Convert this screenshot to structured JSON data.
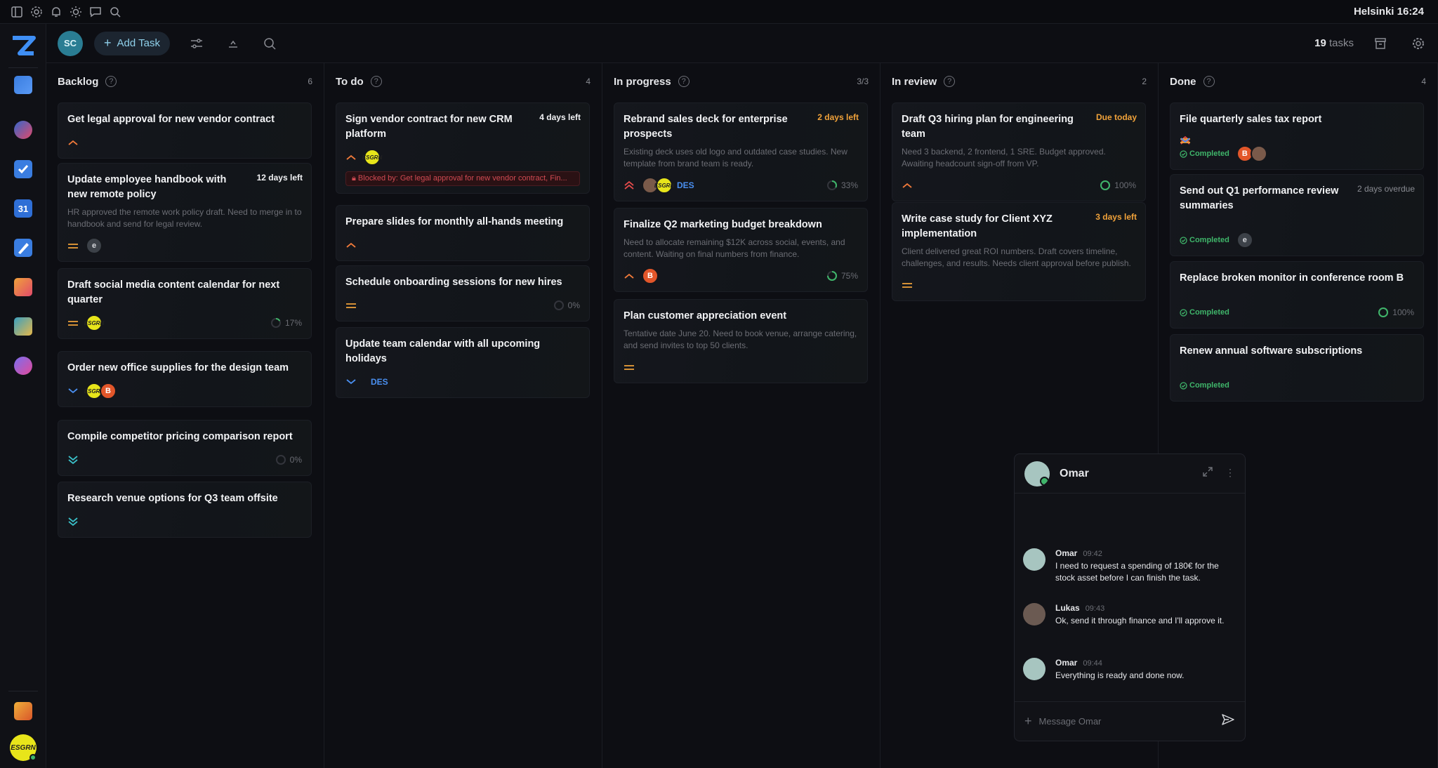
{
  "topbar": {
    "clock": "Helsinki 16:24"
  },
  "toolbar": {
    "user_initials": "SC",
    "add_task_label": "Add Task",
    "task_count": "19",
    "task_count_suffix": "tasks"
  },
  "columns": [
    {
      "title": "Backlog",
      "count": "6",
      "cards": [
        {
          "title": "Get legal approval for new vendor contract",
          "priority": "high"
        },
        {
          "title": "Update employee handbook with new remote policy",
          "due": "12 days left",
          "description": "HR approved the remote work policy draft. Need to merge in to handbook and send for legal review.",
          "priority": "medium",
          "assignees": [
            "e"
          ]
        },
        {
          "title": "Draft social media content calendar for next quarter",
          "priority": "medium",
          "assignees": [
            "ESGRN"
          ],
          "progress": "17%"
        },
        {
          "title": "Order new office supplies for the design team",
          "priority": "low",
          "assignees": [
            "ESGRN",
            "B"
          ]
        },
        {
          "title": "Compile competitor pricing comparison report",
          "priority": "lowest",
          "progress": "0%"
        },
        {
          "title": "Research venue options for Q3 team offsite",
          "priority": "lowest"
        }
      ]
    },
    {
      "title": "To do",
      "count": "4",
      "cards": [
        {
          "title": "Sign vendor contract for new CRM platform",
          "due": "4 days left",
          "priority": "high",
          "assignees": [
            "ESGRN"
          ],
          "blocked": "Blocked by: Get legal approval for new vendor contract, Fin..."
        },
        {
          "title": "Prepare slides for monthly all-hands meeting",
          "priority": "high"
        },
        {
          "title": "Schedule onboarding sessions for new hires",
          "priority": "medium",
          "progress": "0%"
        },
        {
          "title": "Update team calendar with all upcoming holidays",
          "priority": "low",
          "tag": "DES"
        }
      ]
    },
    {
      "title": "In progress",
      "count": "3/3",
      "cards": [
        {
          "title": "Rebrand sales deck for enterprise prospects",
          "due": "2 days left",
          "description": "Existing deck uses old logo and outdated case studies. New template from brand team is ready.",
          "priority": "highest",
          "assignees": [
            "Omar",
            "ESGRN"
          ],
          "tag": "DES",
          "progress": "33%"
        },
        {
          "title": "Finalize Q2 marketing budget breakdown",
          "description": "Need to allocate remaining $12K across social, events, and content. Waiting on final numbers from finance.",
          "priority": "high",
          "assignees": [
            "B"
          ],
          "progress": "75%"
        },
        {
          "title": "Plan customer appreciation event",
          "description": "Tentative date June 20. Need to book venue, arrange catering, and send invites to top 50 clients.",
          "priority": "medium"
        }
      ]
    },
    {
      "title": "In review",
      "count": "2",
      "cards": [
        {
          "title": "Draft Q3 hiring plan for engineering team",
          "due": "Due today",
          "description": "Need 3 backend, 2 frontend, 1 SRE. Budget approved. Awaiting headcount sign-off from VP.",
          "priority": "high",
          "progress": "100%"
        },
        {
          "title": "Write case study for Client XYZ implementation",
          "due": "3 days left",
          "description": "Client delivered great ROI numbers. Draft covers timeline, challenges, and results. Needs client approval before publish.",
          "priority": "medium"
        }
      ]
    },
    {
      "title": "Done",
      "count": "4",
      "cards": [
        {
          "title": "File quarterly sales tax report",
          "priority": "highest",
          "status": "Completed",
          "assignees": [
            "B",
            "Lukas"
          ]
        },
        {
          "title": "Send out Q1 performance review summaries",
          "due": "2 days overdue",
          "priority": "high",
          "status": "Completed",
          "assignees": [
            "e"
          ]
        },
        {
          "title": "Replace broken monitor in conference room B",
          "priority": "medium",
          "status": "Completed",
          "progress": "100%"
        },
        {
          "title": "Renew annual software subscriptions",
          "priority": "low",
          "status": "Completed"
        }
      ]
    }
  ],
  "chat": {
    "name": "Omar",
    "messages": [
      {
        "author": "Omar",
        "time": "09:42",
        "text": "I need to request a spending of 180€ for the stock asset before I can finish the task."
      },
      {
        "author": "Lukas",
        "time": "09:43",
        "text": "Ok, send it through finance and I'll approve it."
      },
      {
        "author": "Omar",
        "time": "09:44",
        "text": "Everything is ready and done now."
      }
    ],
    "input_placeholder": "Message Omar"
  }
}
